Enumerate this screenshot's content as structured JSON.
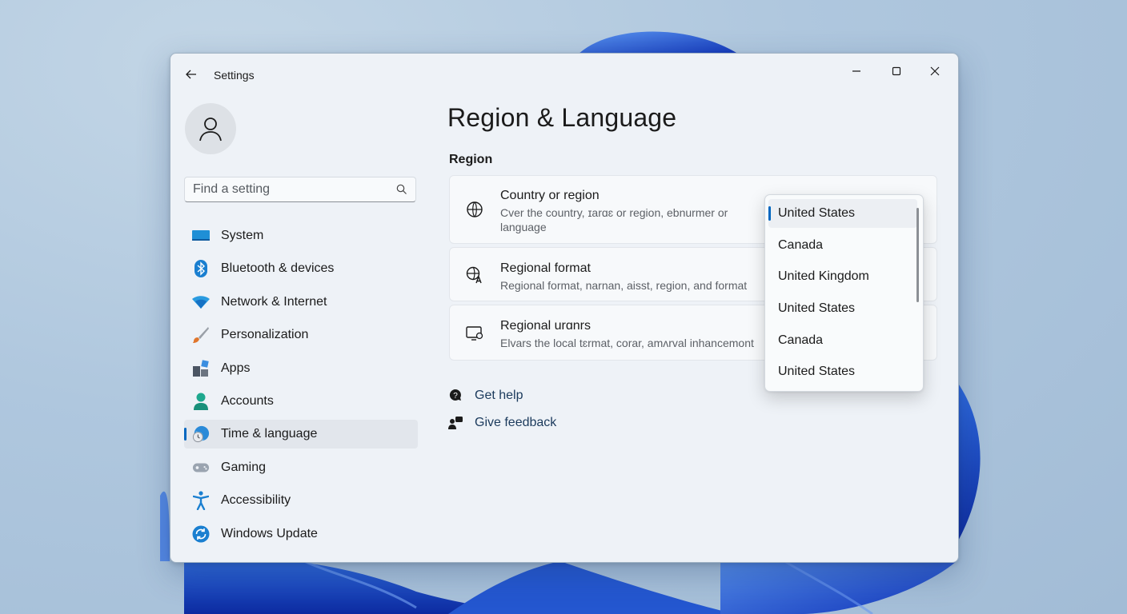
{
  "window": {
    "app_title": "Settings",
    "controls": [
      "minimize",
      "maximize",
      "close"
    ]
  },
  "search": {
    "placeholder": "Find a setting"
  },
  "sidebar": {
    "items": [
      {
        "label": "System",
        "icon": "monitor-icon"
      },
      {
        "label": "Bluetooth & devices",
        "icon": "bluetooth-icon"
      },
      {
        "label": "Network & Internet",
        "icon": "wifi-icon"
      },
      {
        "label": "Personalization",
        "icon": "brush-icon"
      },
      {
        "label": "Apps",
        "icon": "apps-icon"
      },
      {
        "label": "Accounts",
        "icon": "person-icon"
      },
      {
        "label": "Time & language",
        "icon": "globe-clock-icon",
        "active": true
      },
      {
        "label": "Gaming",
        "icon": "gamepad-icon"
      },
      {
        "label": "Accessibility",
        "icon": "accessibility-icon"
      },
      {
        "label": "Windows Update",
        "icon": "update-icon"
      }
    ]
  },
  "main": {
    "title": "Region & Language",
    "section": "Region",
    "cards": [
      {
        "title": "Country or region",
        "description": "Cver the country, ɪarɑɛ or region, ebnurmer or language",
        "icon": "globe-settings-icon"
      },
      {
        "title": "Regional format",
        "description": "Regional format, narnan, aisst, region, and format",
        "icon": "format-icon"
      },
      {
        "title": "Regional urɑnrs",
        "description": "Elvars the local tɛrmat, corar, amʌrval inhancemont",
        "icon": "display-settings-icon"
      }
    ],
    "links": [
      {
        "label": "Get help",
        "icon": "help-icon"
      },
      {
        "label": "Give feedback",
        "icon": "feedback-icon"
      }
    ]
  },
  "dropdown": {
    "options": [
      "United States",
      "Canada",
      "United Kingdom",
      "United States",
      "Canada",
      "United States"
    ],
    "selected_index": 0
  },
  "colors": {
    "accent": "#0067c0",
    "window_bg": "#eef2f7"
  }
}
